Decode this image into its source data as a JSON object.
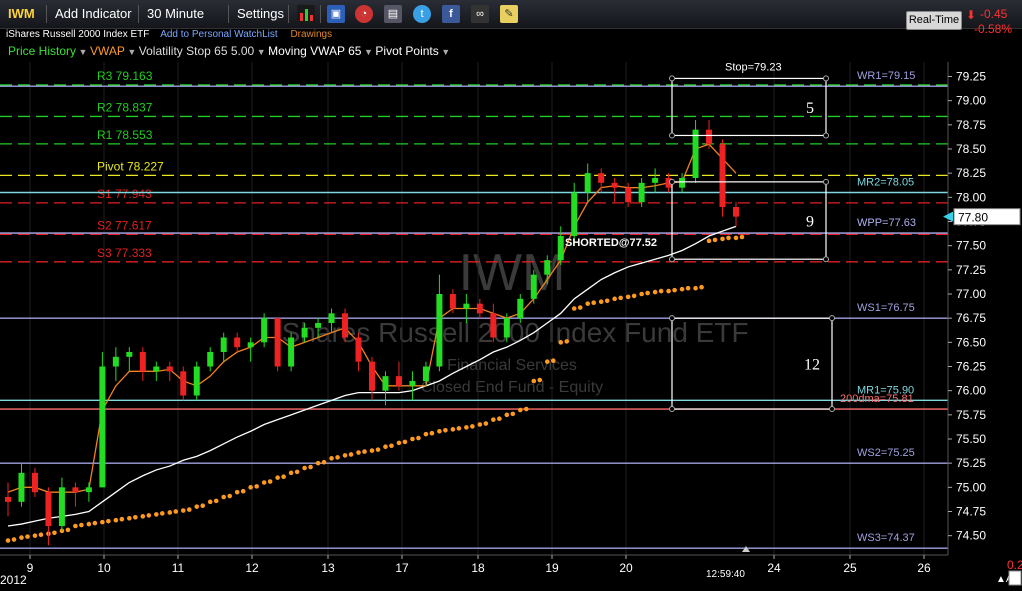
{
  "toolbar": {
    "symbol": "IWM",
    "add_indicator": "Add Indicator",
    "interval": "30 Minute",
    "settings": "Settings",
    "realtime": "Real-Time",
    "change": "-0.45",
    "change_pct": "-0.58%"
  },
  "subheader": {
    "fund_name": "iShares Russell 2000 Index ETF",
    "watchlist": "Add to Personal WatchList",
    "drawings": "Drawings"
  },
  "indicators": {
    "price_history": "Price History",
    "vwap": "VWAP",
    "vol_stop": "Volatility Stop 65 5.00",
    "moving_vwap": "Moving VWAP 65",
    "pivot_points": "Pivot Points"
  },
  "watermark": {
    "symbol": "IWM",
    "name": "iShares Russell 2000 Index Fund ETF",
    "sector": "Financial Services",
    "category": "Closed End Fund - Equity"
  },
  "chart_data": {
    "type": "candlestick",
    "ylim": [
      74.3,
      79.4
    ],
    "y_ticks": [
      "79.25",
      "79.00",
      "78.75",
      "78.50",
      "78.25",
      "78.00",
      "77.75",
      "77.50",
      "77.25",
      "77.00",
      "76.75",
      "76.50",
      "76.25",
      "76.00",
      "75.75",
      "75.50",
      "75.25",
      "75.00",
      "74.75",
      "74.50"
    ],
    "x_ticks": [
      "9",
      "10",
      "11",
      "12",
      "13",
      "17",
      "18",
      "19",
      "20",
      "24",
      "25",
      "26"
    ],
    "year_label": "2012",
    "time_label": "12:59:40",
    "bottom_right_value": "0.25",
    "current_price": "77.80",
    "pivot_levels": [
      {
        "label": "R3 79.163",
        "value": 79.163,
        "color": "#22cc22"
      },
      {
        "label": "R2 78.837",
        "value": 78.837,
        "color": "#22cc22"
      },
      {
        "label": "R1 78.553",
        "value": 78.553,
        "color": "#22cc22"
      },
      {
        "label": "Pivot 78.227",
        "value": 78.227,
        "color": "#e8e820"
      },
      {
        "label": "S1 77.943",
        "value": 77.943,
        "color": "#e02020"
      },
      {
        "label": "S2 77.617",
        "value": 77.617,
        "color": "#e02020"
      },
      {
        "label": "S3 77.333",
        "value": 77.333,
        "color": "#e02020"
      }
    ],
    "weekly_levels": [
      {
        "label": "WR1=79.15",
        "value": 79.15,
        "color": "#a0a0e0"
      },
      {
        "label": "MR2=78.05",
        "value": 78.05,
        "color": "#7fd8e0"
      },
      {
        "label": "WPP=77.63",
        "value": 77.63,
        "color": "#b0b0f0"
      },
      {
        "label": "WS1=76.75",
        "value": 76.75,
        "color": "#a0a0e0"
      },
      {
        "label": "MR1=75.90",
        "value": 75.9,
        "color": "#7fd8e0"
      },
      {
        "label": "200dma=75.81",
        "value": 75.81,
        "color": "#ff7070"
      },
      {
        "label": "WS2=75.25",
        "value": 75.25,
        "color": "#a0a0e0"
      },
      {
        "label": "WS3=74.37",
        "value": 74.37,
        "color": "#a0a0e0"
      }
    ],
    "annotations": {
      "stop": "Stop=79.23",
      "shorted": "SHORTED@77.52",
      "box_labels": [
        "5",
        "9",
        "12"
      ]
    },
    "candles": [
      [
        74.9,
        75.05,
        74.7,
        74.85
      ],
      [
        74.85,
        75.25,
        74.8,
        75.15
      ],
      [
        75.15,
        75.2,
        74.9,
        74.95
      ],
      [
        74.95,
        75.0,
        74.4,
        74.6
      ],
      [
        74.6,
        75.1,
        74.55,
        75.0
      ],
      [
        75.0,
        75.05,
        74.8,
        74.95
      ],
      [
        74.95,
        75.05,
        74.85,
        75.0
      ],
      [
        75.0,
        76.4,
        75.0,
        76.25
      ],
      [
        76.25,
        76.45,
        76.1,
        76.35
      ],
      [
        76.35,
        76.45,
        76.2,
        76.4
      ],
      [
        76.4,
        76.45,
        76.1,
        76.2
      ],
      [
        76.2,
        76.3,
        76.1,
        76.25
      ],
      [
        76.25,
        76.3,
        76.1,
        76.2
      ],
      [
        76.2,
        76.25,
        75.9,
        75.95
      ],
      [
        75.95,
        76.3,
        75.9,
        76.25
      ],
      [
        76.25,
        76.45,
        76.2,
        76.4
      ],
      [
        76.4,
        76.6,
        76.3,
        76.55
      ],
      [
        76.55,
        76.6,
        76.4,
        76.45
      ],
      [
        76.45,
        76.55,
        76.3,
        76.5
      ],
      [
        76.5,
        76.8,
        76.45,
        76.75
      ],
      [
        76.75,
        76.75,
        76.2,
        76.25
      ],
      [
        76.25,
        76.6,
        76.2,
        76.55
      ],
      [
        76.55,
        76.7,
        76.5,
        76.65
      ],
      [
        76.65,
        76.75,
        76.55,
        76.7
      ],
      [
        76.7,
        76.85,
        76.6,
        76.8
      ],
      [
        76.8,
        76.85,
        76.5,
        76.55
      ],
      [
        76.55,
        76.6,
        76.2,
        76.3
      ],
      [
        76.3,
        76.35,
        75.9,
        76.0
      ],
      [
        76.0,
        76.2,
        75.85,
        76.15
      ],
      [
        76.15,
        76.3,
        76.0,
        76.05
      ],
      [
        76.05,
        76.2,
        75.9,
        76.1
      ],
      [
        76.1,
        76.3,
        76.05,
        76.25
      ],
      [
        76.25,
        77.2,
        76.2,
        77.0
      ],
      [
        77.0,
        77.05,
        76.8,
        76.85
      ],
      [
        76.85,
        77.0,
        76.7,
        76.9
      ],
      [
        76.9,
        76.95,
        76.75,
        76.8
      ],
      [
        76.8,
        76.9,
        76.5,
        76.55
      ],
      [
        76.55,
        76.8,
        76.5,
        76.75
      ],
      [
        76.75,
        77.0,
        76.7,
        76.95
      ],
      [
        76.95,
        77.25,
        76.9,
        77.2
      ],
      [
        77.2,
        77.4,
        77.1,
        77.35
      ],
      [
        77.35,
        77.7,
        77.3,
        77.6
      ],
      [
        77.6,
        78.15,
        77.5,
        78.05
      ],
      [
        78.05,
        78.35,
        77.95,
        78.25
      ],
      [
        78.25,
        78.3,
        78.05,
        78.15
      ],
      [
        78.15,
        78.2,
        77.95,
        78.1
      ],
      [
        78.1,
        78.15,
        77.9,
        77.95
      ],
      [
        77.95,
        78.2,
        77.9,
        78.15
      ],
      [
        78.15,
        78.3,
        78.05,
        78.2
      ],
      [
        78.2,
        78.25,
        78.05,
        78.1
      ],
      [
        78.1,
        78.25,
        78.05,
        78.2
      ],
      [
        78.2,
        78.8,
        78.15,
        78.7
      ],
      [
        78.7,
        78.8,
        78.5,
        78.55
      ],
      [
        78.55,
        78.6,
        77.8,
        77.9
      ],
      [
        77.9,
        77.95,
        77.7,
        77.8
      ]
    ],
    "vwap_values": [
      74.95,
      75.0,
      75.0,
      74.95,
      74.95,
      74.95,
      74.98,
      75.8,
      76.05,
      76.2,
      76.2,
      76.2,
      76.22,
      76.1,
      76.05,
      76.15,
      76.3,
      76.4,
      76.45,
      76.55,
      76.55,
      76.45,
      76.5,
      76.55,
      76.6,
      76.65,
      76.5,
      76.25,
      76.05,
      76.05,
      76.05,
      76.05,
      76.75,
      76.85,
      76.85,
      76.85,
      76.8,
      76.75,
      76.8,
      76.95,
      77.15,
      77.35,
      77.7,
      77.95,
      78.1,
      78.12,
      78.1,
      78.1,
      78.12,
      78.15,
      78.16,
      78.5,
      78.55,
      78.4,
      78.25
    ],
    "mvwap_values": [
      74.6,
      74.62,
      74.65,
      74.68,
      74.7,
      74.72,
      74.75,
      74.85,
      74.95,
      75.05,
      75.12,
      75.18,
      75.22,
      75.28,
      75.32,
      75.38,
      75.45,
      75.52,
      75.58,
      75.65,
      75.7,
      75.75,
      75.8,
      75.85,
      75.9,
      75.95,
      75.98,
      75.98,
      75.98,
      75.98,
      76.0,
      76.05,
      76.1,
      76.18,
      76.25,
      76.32,
      76.4,
      76.45,
      76.52,
      76.6,
      76.7,
      76.8,
      76.95,
      77.05,
      77.15,
      77.22,
      77.28,
      77.32,
      77.36,
      77.4,
      77.45,
      77.52,
      77.6,
      77.65,
      77.7
    ],
    "stop_values": [
      74.45,
      74.48,
      74.5,
      74.52,
      74.55,
      74.6,
      74.62,
      74.64,
      74.66,
      74.68,
      74.7,
      74.72,
      74.74,
      74.76,
      74.8,
      74.85,
      74.9,
      74.95,
      75.0,
      75.05,
      75.1,
      75.15,
      75.2,
      75.25,
      75.3,
      75.33,
      75.36,
      75.38,
      75.42,
      75.46,
      75.5,
      75.55,
      75.58,
      75.6,
      75.62,
      75.65,
      75.7,
      75.75,
      75.8,
      76.1,
      76.3,
      76.5,
      76.85,
      76.9,
      76.92,
      76.95,
      76.97,
      77.0,
      77.02,
      77.03,
      77.05,
      77.06,
      77.55,
      77.57,
      77.58
    ]
  }
}
